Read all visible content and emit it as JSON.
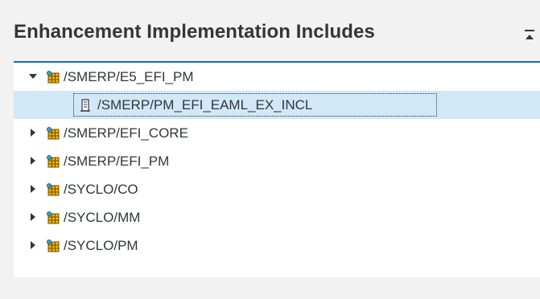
{
  "panel": {
    "title": "Enhancement Implementation Includes"
  },
  "tree": {
    "nodes": [
      {
        "label": "/SMERP/E5_EFI_PM",
        "expanded": true,
        "icon": "enhancement-implementation-icon"
      },
      {
        "label": "/SMERP/PM_EFI_EAML_EX_INCL",
        "selected": true,
        "icon": "include-program-icon"
      },
      {
        "label": "/SMERP/EFI_CORE",
        "expanded": false,
        "icon": "enhancement-implementation-icon"
      },
      {
        "label": "/SMERP/EFI_PM",
        "expanded": false,
        "icon": "enhancement-implementation-icon"
      },
      {
        "label": "/SYCLO/CO",
        "expanded": false,
        "icon": "enhancement-implementation-icon"
      },
      {
        "label": "/SYCLO/MM",
        "expanded": false,
        "icon": "enhancement-implementation-icon"
      },
      {
        "label": "/SYCLO/PM",
        "expanded": false,
        "icon": "enhancement-implementation-icon"
      }
    ]
  },
  "colors": {
    "accent": "#0a6ed1",
    "selection": "#d1e8f8",
    "text": "#32363a"
  }
}
